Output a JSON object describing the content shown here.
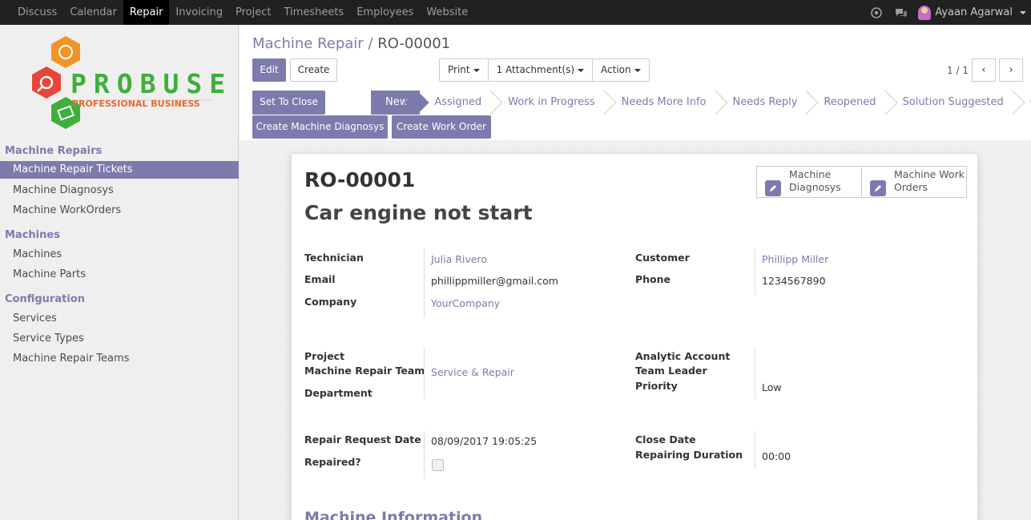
{
  "topnav": {
    "items": [
      "Discuss",
      "Calendar",
      "Repair",
      "Invoicing",
      "Project",
      "Timesheets",
      "Employees",
      "Website"
    ],
    "active_index": 2,
    "user_name": "Ayaan Agarwal"
  },
  "logo": {
    "name": "PROBUSE",
    "tagline": "PROFESSIONAL BUSINESS"
  },
  "sidebar": {
    "sections": [
      {
        "heading": "Machine Repairs",
        "items": [
          "Machine Repair Tickets",
          "Machine Diagnosys",
          "Machine WorkOrders"
        ]
      },
      {
        "heading": "Machines",
        "items": [
          "Machines",
          "Machine Parts"
        ]
      },
      {
        "heading": "Configuration",
        "items": [
          "Services",
          "Service Types",
          "Machine Repair Teams"
        ]
      }
    ],
    "active_item": "Machine Repair Tickets"
  },
  "breadcrumb": {
    "parent": "Machine Repair",
    "separator": "/",
    "current": "RO-00001"
  },
  "buttons": {
    "edit": "Edit",
    "create": "Create",
    "print": "Print",
    "attachments": "1 Attachment(s)",
    "action": "Action",
    "set_to_close": "Set To Close",
    "create_diagnosys": "Create Machine Diagnosys",
    "create_work_order": "Create Work Order"
  },
  "pager": {
    "value": "1 / 1"
  },
  "stages": [
    "New",
    "Assigned",
    "Work in Progress",
    "Needs More Info",
    "Needs Reply",
    "Reopened",
    "Solution Suggested",
    "Closed"
  ],
  "active_stage": "New",
  "smart_buttons": [
    {
      "line1": "Machine",
      "line2": "Diagnosys"
    },
    {
      "line1": "Machine Work",
      "line2": "Orders"
    }
  ],
  "record": {
    "reference": "RO-00001",
    "title": "Car engine not start",
    "labels": {
      "technician": "Technician",
      "email": "Email",
      "company": "Company",
      "customer": "Customer",
      "phone": "Phone",
      "project": "Project",
      "team": "Machine Repair Team",
      "department": "Department",
      "analytic": "Analytic Account",
      "team_leader": "Team Leader",
      "priority": "Priority",
      "request_date": "Repair Request Date",
      "repaired": "Repaired?",
      "close_date": "Close Date",
      "duration": "Repairing Duration"
    },
    "values": {
      "technician": "Julia Rivero",
      "email": "phillippmiller@gmail.com",
      "company": "YourCompany",
      "customer": "Phillipp Miller",
      "phone": "1234567890",
      "team": "Service & Repair",
      "priority": "Low",
      "request_date": "08/09/2017 19:05:25",
      "duration": "00:00"
    },
    "repaired": false
  },
  "section_title": "Machine Information",
  "colors": {
    "accent": "#7c7bad",
    "topbar": "#212121"
  }
}
